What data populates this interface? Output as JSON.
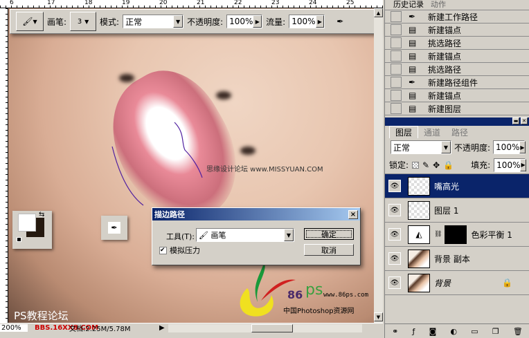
{
  "rulers": {
    "top_ticks": [
      "6",
      "17",
      "18",
      "19",
      "20",
      "21",
      "22",
      "23",
      "24",
      "25"
    ]
  },
  "options_bar": {
    "brush_label": "画笔:",
    "brush_size": "3",
    "mode_label": "模式:",
    "mode_value": "正常",
    "opacity_label": "不透明度:",
    "opacity_value": "100%",
    "flow_label": "流量:",
    "flow_value": "100%"
  },
  "canvas": {
    "watermark_center": "思缘设计论坛 www.MISSYUAN.COM",
    "watermark_bl": "PS教程论坛",
    "logo_86": "86",
    "logo_ps": "ps",
    "logo_url": "www.86ps.com",
    "logo_sub": "中国Photoshop资源网"
  },
  "status": {
    "zoom": "200%",
    "watermark": "BBS.16XX8.COM",
    "doc": "文档:2.25M/5.78M"
  },
  "dialog": {
    "title": "描边路径",
    "tool_label": "工具(T):",
    "tool_value": "画笔",
    "simulate_pressure": "模拟压力",
    "ok": "确定",
    "cancel": "取消",
    "close": "×"
  },
  "history": {
    "tabs": [
      "历史记录",
      "动作"
    ],
    "items": [
      {
        "label": "新建工作路径",
        "icon": "pen"
      },
      {
        "label": "新建锚点",
        "icon": "doc"
      },
      {
        "label": "挑选路径",
        "icon": "doc"
      },
      {
        "label": "新建锚点",
        "icon": "doc"
      },
      {
        "label": "挑选路径",
        "icon": "doc"
      },
      {
        "label": "新建路径组件",
        "icon": "pen"
      },
      {
        "label": "新建锚点",
        "icon": "doc"
      },
      {
        "label": "新建图层",
        "icon": "doc"
      }
    ]
  },
  "layers": {
    "tabs": [
      "图层",
      "通道",
      "路径"
    ],
    "blend": "正常",
    "opacity_label": "不透明度:",
    "opacity": "100%",
    "lock_label": "锁定:",
    "fill_label": "填充:",
    "fill": "100%",
    "items": [
      {
        "name": "嘴高光",
        "selected": true
      },
      {
        "name": "图层 1"
      },
      {
        "name": "色彩平衡 1"
      },
      {
        "name": "背景 副本"
      },
      {
        "name": "背景",
        "locked": true
      }
    ]
  }
}
